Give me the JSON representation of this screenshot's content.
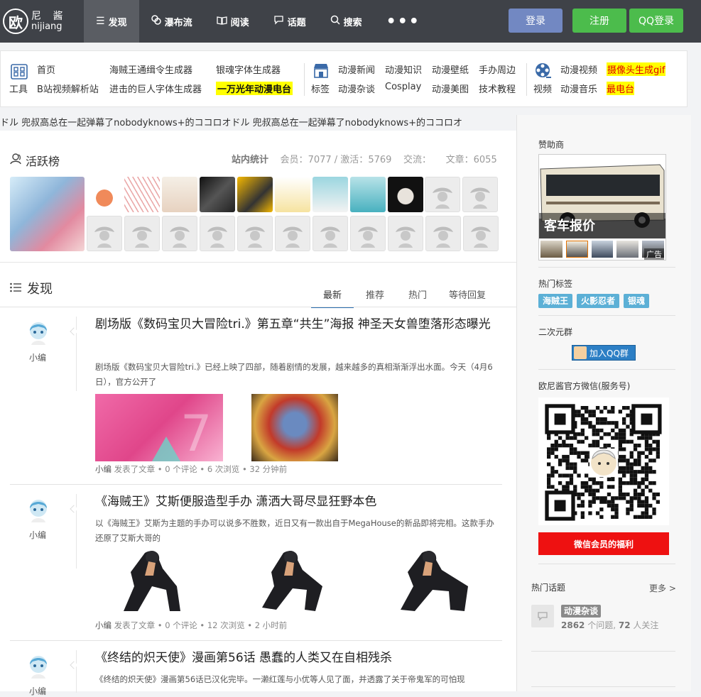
{
  "logo": {
    "glyph": "欧",
    "cn": "尼 酱",
    "en": "nijiang"
  },
  "nav": {
    "items": [
      {
        "icon": "list-icon",
        "glyph": "☰",
        "label": "发现",
        "active": true
      },
      {
        "icon": "waterfall-icon",
        "glyph": "⚇",
        "label": "瀑布流"
      },
      {
        "icon": "book-icon",
        "glyph": "📖",
        "label": "阅读"
      },
      {
        "icon": "chat-icon",
        "glyph": "🗨",
        "label": "话题"
      },
      {
        "icon": "search-icon",
        "glyph": "⚲",
        "label": "搜索"
      }
    ],
    "more": "•••",
    "login": "登录",
    "register": "注册",
    "qq_login": "QQ登录"
  },
  "quick_links": {
    "group1": {
      "icon": "grid-icon",
      "icon_label": "工具",
      "links": [
        "首页",
        "海贼王通缉令生成器",
        "银魂字体生成器",
        "B站视频解析站",
        "进击的巨人字体生成器",
        "一万光年动漫电台"
      ]
    },
    "group2": {
      "icon": "store-icon",
      "icon_label": "标签",
      "links": [
        "动漫新闻",
        "动漫知识",
        "动漫壁纸",
        "手办周边",
        "动漫杂谈",
        "Cosplay",
        "动漫美图",
        "技术教程"
      ]
    },
    "group3": {
      "icon": "film-reel-icon",
      "icon_label": "视频",
      "links": [
        "动漫视频",
        "摄像头生成gif",
        "动漫音乐",
        "最电台"
      ]
    }
  },
  "marquee": {
    "text": "ドル   兜叔高总在一起弹幕了nobodyknows+的ココロオドル   兜叔高总在一起弹幕了nobodyknows+的ココロオ"
  },
  "active_board": {
    "title": "活跃榜",
    "stats_label": "站内统计",
    "members_label": "会员：",
    "members": "7077",
    "active_label": "/ 激活：",
    "active": "5769",
    "exchange_label": "交流：",
    "articles_label": "文章：",
    "articles": "6055"
  },
  "discover": {
    "title": "发现",
    "tabs": [
      "最新",
      "推荐",
      "热门",
      "等待回复"
    ]
  },
  "posts": [
    {
      "author": "小编",
      "title": "剧场版《数码宝贝大冒险tri.》第五章“共生”海报 神圣天女兽堕落形态曝光",
      "excerpt": "剧场版《数码宝贝大冒险tri.》已经上映了四部，随着剧情的发展，越来越多的真相渐渐浮出水面。今天（4月6日），官方公开了",
      "meta_author": "小编",
      "meta": " 发表了文章 • 0 个评论 • 6 次浏览 • 32 分钟前"
    },
    {
      "author": "小编",
      "title": "《海贼王》艾斯便服造型手办 潇洒大哥尽显狂野本色",
      "excerpt": "以《海贼王》艾斯为主题的手办可以说多不胜数，近日又有一款出自于MegaHouse的新品即将完相。这款手办还原了艾斯大哥的",
      "meta_author": "小编",
      "meta": " 发表了文章 • 0 个评论 • 12 次浏览 • 2 小时前"
    },
    {
      "author": "小编",
      "title": "《终结的炽天使》漫画第56话 愚蠢的人类又在自相残杀",
      "excerpt": "《终结的炽天使》漫画第56话已汉化完毕。一濑红莲与小优等人见了面，并透露了关于帝鬼军的可怕现"
    }
  ],
  "sidebar": {
    "sponsor_title": "赞助商",
    "ad_caption": "客车报价",
    "ad_badge": "广告",
    "hot_tags_title": "热门标签",
    "tags": [
      "海贼王",
      "火影忍者",
      "银魂"
    ],
    "acg_title": "二次元群",
    "qq_group": "加入QQ群",
    "wechat_title": "欧尼酱官方微信(服务号)",
    "wechat_button": "微信会员的福利",
    "hot_topics_title": "热门话题",
    "more": "更多 >",
    "topic_name": "动漫杂谈",
    "topic_questions": "2862",
    "topic_q_label": " 个问题, ",
    "topic_followers": "72",
    "topic_f_label": " 人关注"
  },
  "colors": {
    "nav_bg": "#3f4248",
    "login": "#7288c2",
    "register": "#4cbc4c",
    "tag": "#5cb0d6",
    "qq_group": "#2c7fc5",
    "wechat_button": "#ee1111",
    "highlight": "#ffff00"
  }
}
